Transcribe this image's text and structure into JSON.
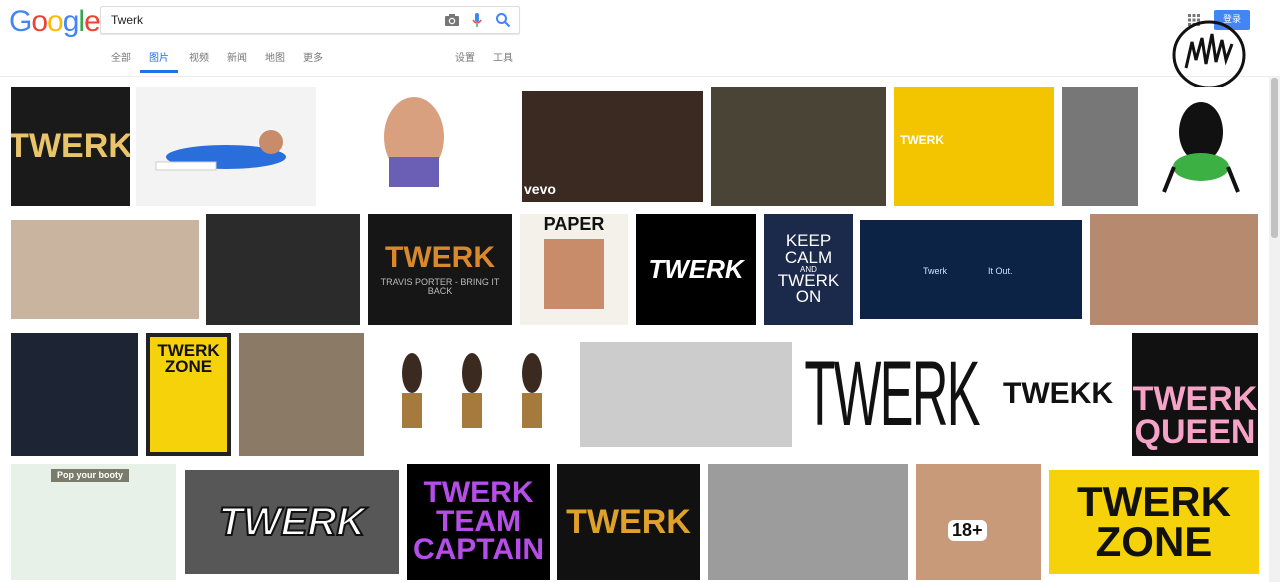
{
  "logo": {
    "text": "Google"
  },
  "search": {
    "query": "Twerk"
  },
  "tabs": {
    "all": "全部",
    "images": "图片",
    "videos": "视频",
    "news": "新闻",
    "maps": "地图",
    "more": "更多",
    "settings": "设置",
    "tools": "工具"
  },
  "account": {
    "login": "登录"
  },
  "results": {
    "r1": "TWERK",
    "r2": "TWERK",
    "r3": "vevo",
    "r4": "TWERK",
    "r5": "PAPER",
    "r6": "TWERK",
    "r7_line1": "KEEP",
    "r7_line2": "CALM",
    "r7_line3": "AND",
    "r7_line4": "TWERK",
    "r7_line5": "ON",
    "r8_a": "Twerk",
    "r8_b": "It Out.",
    "r9_line1": "TWERK",
    "r9_line2": "ZONE",
    "r10": "TWERK",
    "r11": "TWEKK",
    "r12_line1": "TWERK",
    "r12_line2": "QUEEN",
    "r13": "Pop your booty",
    "r14": "TWERK",
    "r15_line1": "TWERK",
    "r15_line2": "TEAM",
    "r15_line3": "CAPTAIN",
    "r16": "TWERK",
    "r17": "18+",
    "r18_line1": "TWERK",
    "r18_line2": "ZONE",
    "r19": "TRAVIS PORTER - BRING IT BACK",
    "r20": "Twerk"
  }
}
